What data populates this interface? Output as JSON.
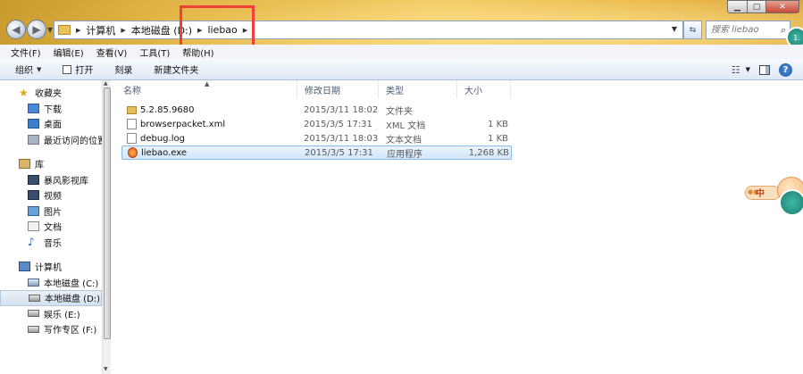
{
  "window": {
    "minimize_label": "▁",
    "maximize_label": "▢",
    "close_label": "✕"
  },
  "address": {
    "crumbs": [
      "计算机",
      "本地磁盘 (D:)",
      "liebao"
    ]
  },
  "search": {
    "placeholder": "搜索 liebao"
  },
  "menu": {
    "items": [
      "文件(F)",
      "编辑(E)",
      "查看(V)",
      "工具(T)",
      "帮助(H)"
    ]
  },
  "toolbar": {
    "organize": "组织",
    "open": "打开",
    "burn": "刻录",
    "new_folder": "新建文件夹"
  },
  "nav": {
    "favorites": {
      "label": "收藏夹",
      "items": [
        "下载",
        "桌面",
        "最近访问的位置"
      ]
    },
    "libraries": {
      "label": "库",
      "items": [
        "暴风影视库",
        "视频",
        "图片",
        "文档",
        "音乐"
      ]
    },
    "computer": {
      "label": "计算机",
      "items": [
        "本地磁盘 (C:)",
        "本地磁盘 (D:)",
        "娱乐 (E:)",
        "写作专区 (F:)"
      ],
      "selected_index": 1
    }
  },
  "columns": {
    "name": "名称",
    "date": "修改日期",
    "type": "类型",
    "size": "大小"
  },
  "files": [
    {
      "name": "5.2.85.9680",
      "date": "2015/3/11 18:02",
      "type": "文件夹",
      "size": "",
      "icon": "folder-icon"
    },
    {
      "name": "browserpacket.xml",
      "date": "2015/3/5 17:31",
      "type": "XML 文档",
      "size": "1 KB",
      "icon": "xml-file-icon"
    },
    {
      "name": "debug.log",
      "date": "2015/3/11 18:03",
      "type": "文本文档",
      "size": "1 KB",
      "icon": "text-file-icon"
    },
    {
      "name": "liebao.exe",
      "date": "2015/3/5 17:31",
      "type": "应用程序",
      "size": "1,268 KB",
      "icon": "liebao-app-icon"
    }
  ],
  "selected_file_index": 3,
  "mascot": {
    "text": "中"
  },
  "colors": {
    "highlight_box": "#f0403a",
    "selection": "#d3e6fb"
  }
}
